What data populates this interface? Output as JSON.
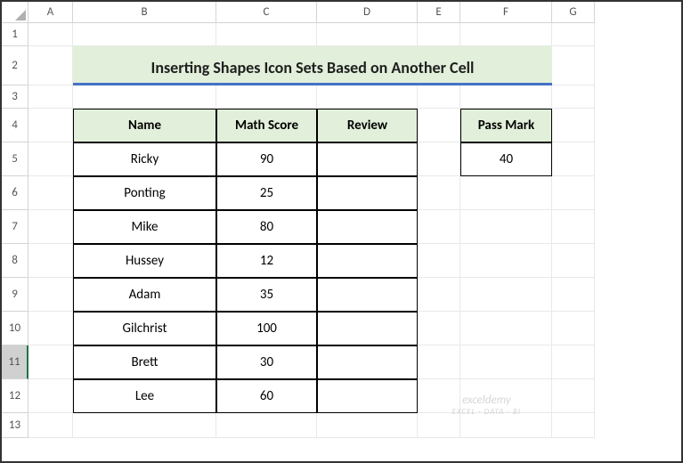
{
  "columns": [
    "",
    "A",
    "B",
    "C",
    "D",
    "E",
    "F",
    "G"
  ],
  "rows": [
    "1",
    "2",
    "3",
    "4",
    "5",
    "6",
    "7",
    "8",
    "9",
    "10",
    "11",
    "12",
    "13"
  ],
  "selected_row": "11",
  "title": "Inserting Shapes Icon Sets Based on Another Cell",
  "table": {
    "headers": [
      "Name",
      "Math Score",
      "Review"
    ],
    "data": [
      {
        "name": "Ricky",
        "score": "90",
        "review": ""
      },
      {
        "name": "Ponting",
        "score": "25",
        "review": ""
      },
      {
        "name": "Mike",
        "score": "80",
        "review": ""
      },
      {
        "name": "Hussey",
        "score": "12",
        "review": ""
      },
      {
        "name": "Adam",
        "score": "35",
        "review": ""
      },
      {
        "name": "Gilchrist",
        "score": "100",
        "review": ""
      },
      {
        "name": "Brett",
        "score": "30",
        "review": ""
      },
      {
        "name": "Lee",
        "score": "60",
        "review": ""
      }
    ]
  },
  "pass_mark": {
    "label": "Pass Mark",
    "value": "40"
  },
  "watermark": {
    "main": "exceldemy",
    "sub": "EXCEL · DATA · BI"
  }
}
